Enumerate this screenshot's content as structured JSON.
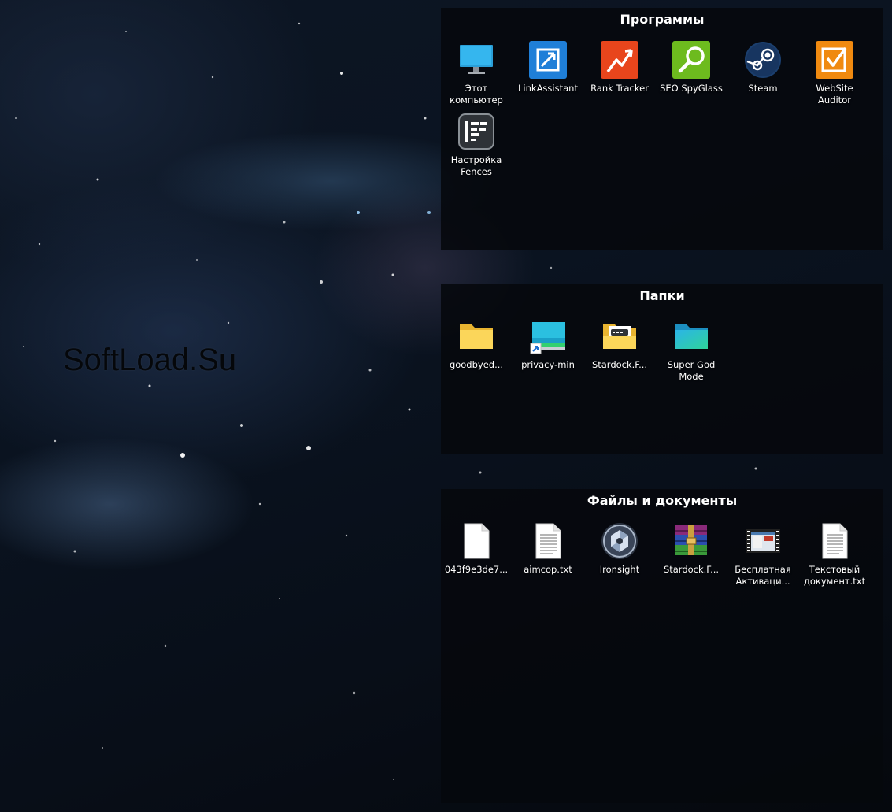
{
  "watermark": "SoftLoad.Su",
  "fences": {
    "programs": {
      "title": "Программы",
      "items": [
        {
          "label": "Этот компьютер",
          "icon": "monitor-icon"
        },
        {
          "label": "LinkAssistant",
          "icon": "linkassistant-icon"
        },
        {
          "label": "Rank Tracker",
          "icon": "rank-tracker-icon"
        },
        {
          "label": "SEO SpyGlass",
          "icon": "seo-spyglass-icon"
        },
        {
          "label": "Steam",
          "icon": "steam-icon"
        },
        {
          "label": "WebSite Auditor",
          "icon": "website-auditor-icon"
        },
        {
          "label": "Настройка Fences",
          "icon": "fences-settings-icon"
        }
      ]
    },
    "folders": {
      "title": "Папки",
      "items": [
        {
          "label": "goodbyed...",
          "icon": "folder-icon"
        },
        {
          "label": "privacy-min",
          "icon": "folder-shortcut-icon"
        },
        {
          "label": "Stardock.F...",
          "icon": "folder-doc-icon"
        },
        {
          "label": "Super God Mode",
          "icon": "folder-teal-icon"
        }
      ]
    },
    "files": {
      "title": "Файлы и документы",
      "items": [
        {
          "label": "043f9e3de7...",
          "icon": "blank-file-icon"
        },
        {
          "label": "aimcop.txt",
          "icon": "text-file-icon"
        },
        {
          "label": "Ironsight",
          "icon": "ironsight-icon"
        },
        {
          "label": "Stardock.F...",
          "icon": "winrar-archive-icon"
        },
        {
          "label": "Бесплатная Активаци...",
          "icon": "video-file-icon"
        },
        {
          "label": "Текстовый документ.txt",
          "icon": "text-file-icon"
        }
      ]
    }
  },
  "colors": {
    "fence_bg": "#06080c",
    "linkassistant": "#1f7fd8",
    "rank_tracker": "#e8451c",
    "seo_spyglass": "#6dbb1e",
    "website_auditor": "#f08a10",
    "steam": "#1b3f6e"
  }
}
